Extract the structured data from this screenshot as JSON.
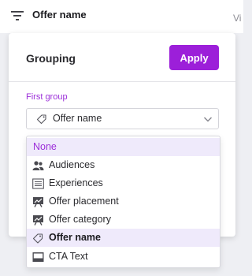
{
  "topbar": {
    "title": "Offer name",
    "right_text": "Vi"
  },
  "panel": {
    "title": "Grouping",
    "apply_label": "Apply",
    "field_label": "First group",
    "select_value": "Offer name"
  },
  "dropdown": {
    "options": [
      {
        "label": "None",
        "icon": "none"
      },
      {
        "label": "Audiences",
        "icon": "people-icon"
      },
      {
        "label": "Experiences",
        "icon": "list-icon"
      },
      {
        "label": "Offer placement",
        "icon": "chart-board-icon"
      },
      {
        "label": "Offer category",
        "icon": "chart-board-icon"
      },
      {
        "label": "Offer name",
        "icon": "tag-icon",
        "selected": true
      },
      {
        "label": "CTA Text",
        "icon": "window-icon"
      }
    ]
  },
  "colors": {
    "accent": "#9c1fd9",
    "highlight": "#efeafb"
  }
}
